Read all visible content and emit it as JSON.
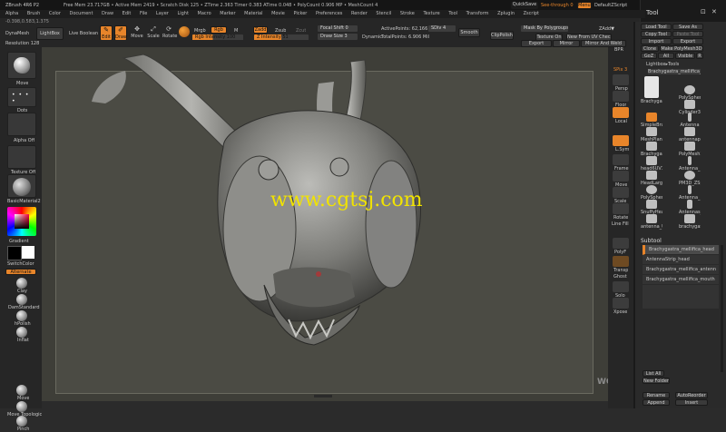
{
  "app": {
    "title": "ZBrush 4R6 P2",
    "status": "Free Mem 23.717GB • Active Mem 2419 • Scratch Disk 125 • ZTime 2.363 Timer 0.383 ATime 0.048 • PolyCount 0.906 MP • MeshCount 4",
    "quicksave": "QuickSave",
    "seethrough": "See-through 0",
    "menus": "Menus",
    "default_script": "DefaultZScript"
  },
  "menu_items": [
    "Alpha",
    "Brush",
    "Color",
    "Document",
    "Draw",
    "Edit",
    "File",
    "Layer",
    "Light",
    "Macro",
    "Marker",
    "Material",
    "Movie",
    "Picker",
    "Preferences",
    "Render",
    "Stencil",
    "Stroke",
    "Texture",
    "Tool",
    "Transform",
    "Zplugin",
    "Zscript"
  ],
  "coords": "-0.398,0.583,1.375",
  "toolbar": {
    "dynamesh": "DynaMesh",
    "lightbox": "LightBox",
    "live_boolean": "Live Boolean",
    "edit": "Edit",
    "draw": "Draw",
    "move": "Move",
    "scale": "Scale",
    "rotate": "Rotate",
    "mrgb": "Mrgb",
    "rgb": "Rgb",
    "m": "M",
    "zadd": "Zadd",
    "zsub": "Zsub",
    "zcut": "Zcut",
    "rgb_intensity": "Rgb Intensity 100",
    "z_intensity": "Z Intensity 51",
    "focal_shift": "Focal Shift 0",
    "draw_size": "Draw Size 3",
    "dynamic": "Dynamic",
    "active_points": "ActivePoints: 62,166",
    "total_points": "TotalPoints: 6.906 Mil",
    "sdiv": "SDiv 4",
    "smooth": "Smooth",
    "clip_polish": "ClipPolish",
    "mask_by_polygroups": "Mask By Polygroups 100",
    "texture_on": "Texture On",
    "new_from_uv": "New From UV Check",
    "zadd_top": "ZAdd▼",
    "export": "Export",
    "mirror": "Mirror",
    "mirror_weld": "Mirror And Weld",
    "resolution": "Resolution 128"
  },
  "left_shelf": {
    "brush_label": "Move",
    "stroke_label": "Dots",
    "alpha_label": "Alpha Off",
    "texture_label": "Texture Off",
    "material_label": "BasicMaterial2",
    "gradient_label": "Gradient",
    "switch_color": "SwitchColor",
    "alternate": "Alternate",
    "brushes": [
      "Clay",
      "DamStandard",
      "hPolish",
      "Inflat",
      "Move",
      "Move Topologic",
      "Pinch"
    ]
  },
  "right_tools": [
    "BPR",
    "SPix 3",
    "Persp",
    "Floor",
    "Local",
    "L.Sym",
    "Frame",
    "Move",
    "Scale",
    "Rotate",
    "Line Fill",
    "PolyF",
    "Transp",
    "Ghost",
    "Solo",
    "Xpose"
  ],
  "tool_panel": {
    "header": "Tool",
    "buttons": [
      "Load Tool",
      "Save As",
      "Copy Tool",
      "Paste Tool",
      "Import",
      "Export",
      "Clone",
      "Make PolyMesh3D",
      "GoZ",
      "All",
      "Visible",
      "R"
    ],
    "lightbox_tools": "Lightbox▸Tools",
    "current_tool": "Brachygastra_mellifica_head_48",
    "tools": [
      "Brachygastra_m",
      "PolySphere",
      "Cylinder3D",
      "SimpleBrush",
      "Antenna",
      "MeshPlanes_1",
      "antennapanel",
      "Brachygastra_m",
      "PolyMesh3D",
      "head6UV1",
      "Antenna_1",
      "HeadLargeHair",
      "PM3D_ZSphere",
      "PolySphere",
      "Antenna_1",
      "SnuffyHead",
      "Antennas_1",
      "antenna_UV",
      "brachygastra_head"
    ],
    "subtool_header": "Subtool",
    "subtools": [
      "Brachygastra_mellifica_head",
      "AntennaStrip_head",
      "Brachygastra_mellifica_antenn",
      "Brachygastra_mellifica_mouth"
    ],
    "list_all": "List All",
    "new_folder": "New Folder",
    "rename": "Rename",
    "auto_reorder": "AutoReorder",
    "append": "Append",
    "insert": "Insert"
  },
  "watermark": "www.cgtsj.com",
  "logo_text": "WORKSHOP",
  "colors": {
    "accent": "#e8852a",
    "canvas": "#4a4a44",
    "watermark": "#f1e300"
  }
}
